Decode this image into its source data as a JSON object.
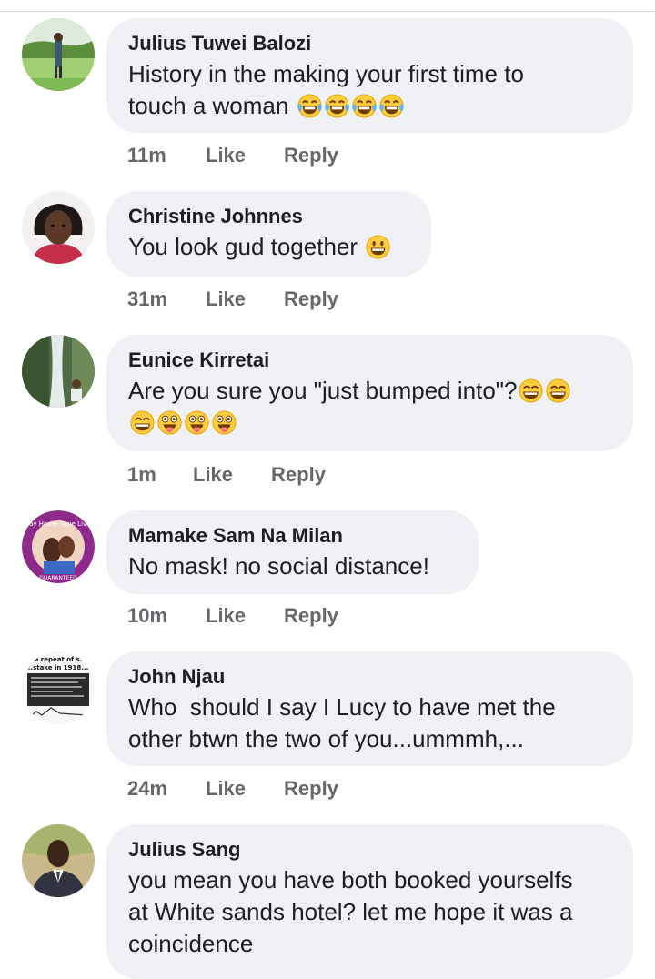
{
  "comments": [
    {
      "author": "Julius Tuwei Balozi",
      "line1": "History in the making your first time to",
      "line2": "touch a woman",
      "time": "11m",
      "like": "Like",
      "reply": "Reply",
      "emojis": [
        "tears-of-joy",
        "tears-of-joy",
        "tears-of-joy",
        "tears-of-joy"
      ]
    },
    {
      "author": "Christine Johnnes",
      "line1": "You look gud together",
      "time": "31m",
      "like": "Like",
      "reply": "Reply",
      "emojis": [
        "grinning"
      ]
    },
    {
      "author": "Eunice Kirretai",
      "line1": "Are you sure you \"just bumped into\"?",
      "time": "1m",
      "like": "Like",
      "reply": "Reply",
      "emojis": [
        "grin",
        "grin",
        "grin",
        "zany",
        "zany",
        "zany"
      ]
    },
    {
      "author": "Mamake Sam Na Milan",
      "line1": "No mask! no social distance!",
      "time": "10m",
      "like": "Like",
      "reply": "Reply",
      "avatar_text": {
        "top": "Stay Home Save Lives",
        "bottom": "GUARANTEED"
      }
    },
    {
      "author": "John Njau",
      "line1": "Who  should I say I Lucy to have met the",
      "line2": "other btwn the two of you...ummmh,...",
      "time": "24m",
      "like": "Like",
      "reply": "Reply",
      "avatar_text": {
        "line1": "..a repeat of s...",
        "line2": "..stake in 1918..."
      }
    },
    {
      "author": "Julius Sang",
      "line1": "you mean you have both booked yourselfs",
      "line2": "at White sands hotel? let me hope it was a",
      "line3": "coincidence"
    }
  ],
  "colors": {
    "bubble": "#eff1f4",
    "author": "#1c1e21",
    "meta": "#65676b",
    "emoji_face": "#ffcc3d",
    "emoji_tear": "#5db3ff"
  }
}
